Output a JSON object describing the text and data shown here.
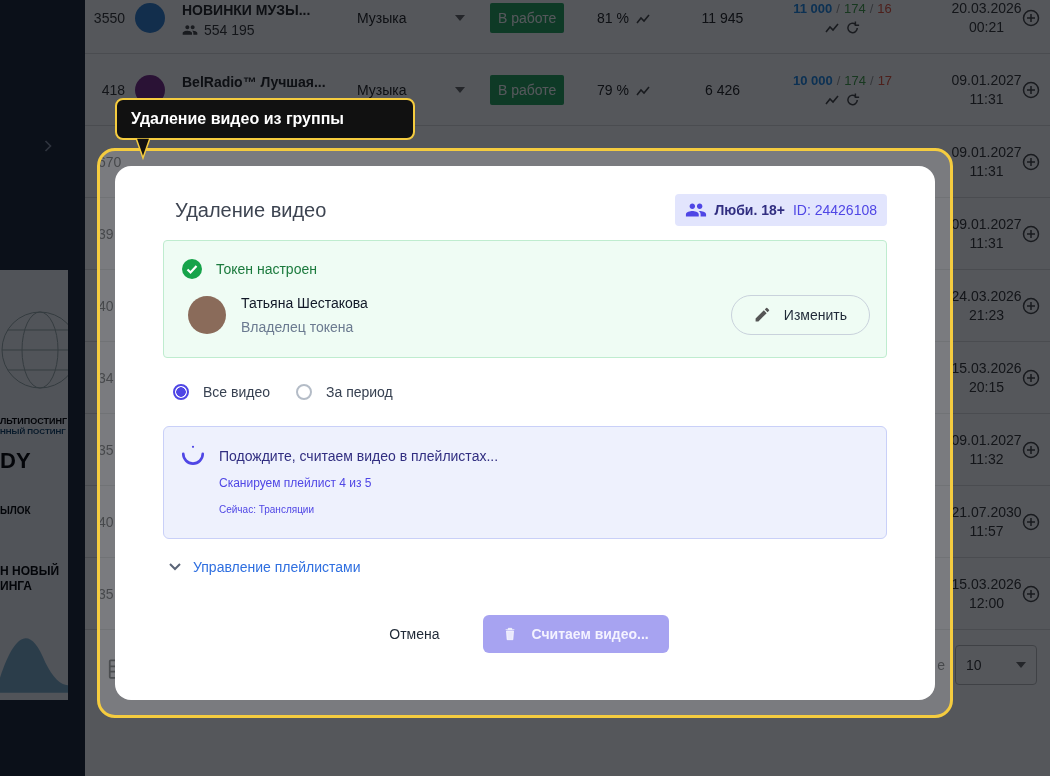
{
  "banner": {
    "texts": [
      "ЛЬТИПОСТИНГ",
      "ННЫЙ ПОСТИНГ",
      "DY",
      "ЫЛОК",
      "Н НОВЫЙ",
      "ИНГА"
    ]
  },
  "table": {
    "stats_separator": "/",
    "rows": [
      {
        "kind": "full",
        "number": "3550",
        "name": "НОВИНКИ МУЗЫ...",
        "subscribers": "554 195",
        "category": "Музыка",
        "status": "В работе",
        "percent": "81 %",
        "count": "11 945",
        "stats": [
          "11 000",
          "174",
          "16"
        ],
        "date": "20.03.2026",
        "time": "00:21"
      },
      {
        "kind": "full",
        "number": "418",
        "name": "BelRadio™ Лучшая...",
        "category": "Музыка",
        "status": "В работе",
        "percent": "79 %",
        "count": "6 426",
        "stats": [
          "10 000",
          "174",
          "17"
        ],
        "date": "09.01.2027",
        "time": "11:31"
      },
      {
        "kind": "partial",
        "number": "670",
        "date": "09.01.2027",
        "time": "11:31"
      },
      {
        "kind": "partial",
        "number": "39",
        "date": "09.01.2027",
        "time": "11:31"
      },
      {
        "kind": "partial",
        "number": "40",
        "date": "24.03.2026",
        "time": "21:23"
      },
      {
        "kind": "partial",
        "number": "34",
        "date": "15.03.2026",
        "time": "20:15"
      },
      {
        "kind": "partial",
        "number": "35",
        "date": "09.01.2027",
        "time": "11:32"
      },
      {
        "kind": "partial",
        "number": "40",
        "date": "21.07.2030",
        "time": "11:57"
      },
      {
        "kind": "partial",
        "number": "35",
        "date": "15.03.2026",
        "time": "12:00"
      }
    ]
  },
  "footer": {
    "page_size_label": "e",
    "page_size": "10"
  },
  "tooltip": {
    "text": "Удаление видео из группы"
  },
  "modal": {
    "title": "Удаление видео",
    "group": {
      "name": "Люби. 18+",
      "id": "ID: 24426108"
    },
    "token": {
      "status": "Токен настроен",
      "owner_name": "Татьяна Шестакова",
      "owner_role": "Владелец токена",
      "edit_button": "Изменить"
    },
    "period_options": [
      {
        "label": "Все видео",
        "selected": true
      },
      {
        "label": "За период",
        "selected": false
      }
    ],
    "progress": {
      "title": "Подождите, считаем видео в плейлистах...",
      "step": "Сканируем плейлист 4 из 5",
      "current": "Сейчас: Трансляции"
    },
    "playlists_toggle": {
      "label": "Управление плейлистами",
      "expanded": false
    },
    "cancel_button": "Отмена",
    "submit_button": {
      "label": "Считаем видео...",
      "disabled": true
    }
  }
}
